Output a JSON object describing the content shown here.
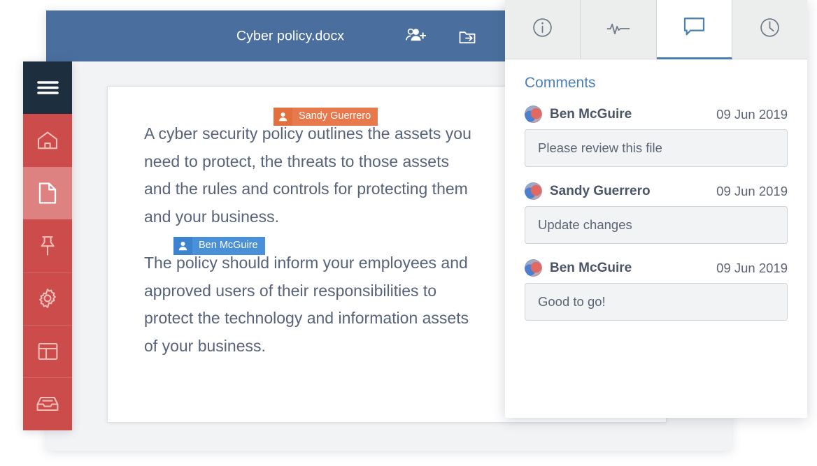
{
  "window": {
    "header": {
      "title": "Cyber policy.docx",
      "share_icon": "add-people-icon",
      "export_icon": "export-to-folder-icon",
      "background_color": "#4a6f9e"
    }
  },
  "sidebar": {
    "items": [
      {
        "icon": "hamburger-menu-icon",
        "name": "menu",
        "state": "menu"
      },
      {
        "icon": "home-icon",
        "name": "home",
        "state": "normal"
      },
      {
        "icon": "document-icon",
        "name": "documents",
        "state": "active"
      },
      {
        "icon": "pin-icon",
        "name": "pinned",
        "state": "normal"
      },
      {
        "icon": "gear-icon",
        "name": "settings",
        "state": "normal"
      },
      {
        "icon": "layout-icon",
        "name": "dashboard",
        "state": "normal"
      },
      {
        "icon": "inbox-icon",
        "name": "inbox",
        "state": "normal"
      }
    ],
    "colors": {
      "menu": "#1d2f3f",
      "normal": "#cc4c4c",
      "active": "#dd8281"
    }
  },
  "document": {
    "paragraphs": [
      "A cyber security policy outlines the assets you need to protect, the threats to those assets and the rules and controls for protecting them and your business.",
      "The policy should inform your employees and approved users of their responsibilities to protect the technology and information assets of your business."
    ],
    "badges": [
      {
        "label": "Sandy Guerrero",
        "color": "#e8794d",
        "icon": "user-icon"
      },
      {
        "label": "Ben McGuire",
        "color": "#4a90d9",
        "icon": "user-icon"
      }
    ]
  },
  "panel": {
    "tabs": [
      {
        "icon": "info-icon",
        "label": "Info",
        "active": false
      },
      {
        "icon": "activity-pulse-icon",
        "label": "Activity",
        "active": false
      },
      {
        "icon": "comment-bubble-icon",
        "label": "Comments",
        "active": true
      },
      {
        "icon": "clock-icon",
        "label": "History",
        "active": false
      }
    ],
    "title": "Comments",
    "accent_color": "#4a7fb5",
    "comments": [
      {
        "author": "Ben McGuire",
        "date": "09 Jun 2019",
        "text": "Please review this file"
      },
      {
        "author": "Sandy Guerrero",
        "date": "09 Jun 2019",
        "text": "Update changes"
      },
      {
        "author": "Ben McGuire",
        "date": "09 Jun 2019",
        "text": "Good to go!"
      }
    ]
  }
}
